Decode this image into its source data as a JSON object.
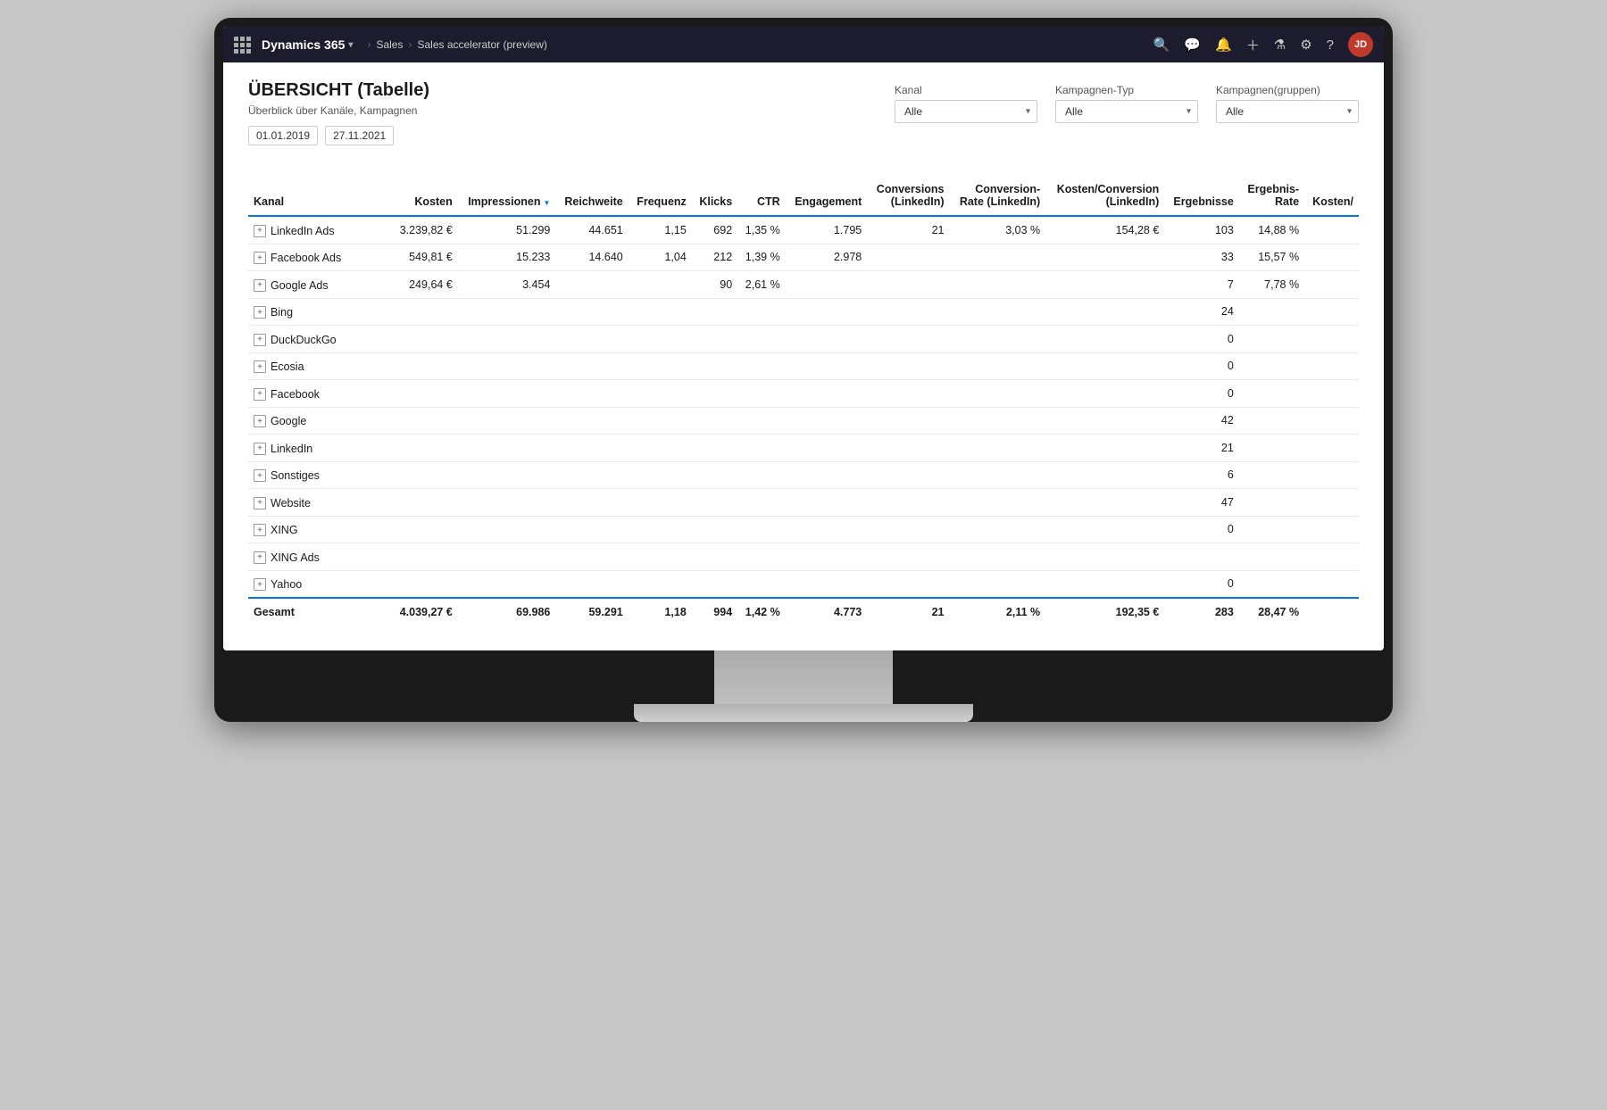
{
  "app": {
    "brand": "Dynamics 365",
    "breadcrumb": [
      "Sales",
      "Sales accelerator (preview)"
    ]
  },
  "topbar_icons": [
    "search",
    "chat",
    "notifications",
    "add",
    "funnel",
    "settings",
    "help"
  ],
  "topbar_avatar_initials": "JD",
  "page": {
    "title": "ÜBERSICHT (Tabelle)",
    "subtitle": "Überblick über Kanäle, Kampagnen",
    "date_from": "01.01.2019",
    "date_to": "27.11.2021"
  },
  "filters": {
    "kanal": {
      "label": "Kanal",
      "value": "Alle"
    },
    "kampagnen_typ": {
      "label": "Kampagnen-Typ",
      "value": "Alle"
    },
    "kampagnen_gruppen": {
      "label": "Kampagnen(gruppen)",
      "value": "Alle"
    }
  },
  "table": {
    "columns": [
      "Kanal",
      "Kosten",
      "Impressionen",
      "Reichweite",
      "Frequenz",
      "Klicks",
      "CTR",
      "Engagement",
      "Conversions (LinkedIn)",
      "Conversion-Rate (LinkedIn)",
      "Kosten/Conversion (LinkedIn)",
      "Ergebnisse",
      "Ergebnis-Rate",
      "Kosten/"
    ],
    "rows": [
      {
        "kanal": "LinkedIn Ads",
        "kosten": "3.239,82 €",
        "impressionen": "51.299",
        "reichweite": "44.651",
        "frequenz": "1,15",
        "klicks": "692",
        "ctr": "1,35 %",
        "engagement": "1.795",
        "conversions_li": "21",
        "conv_rate_li": "3,03 %",
        "kosten_conv_li": "154,28 €",
        "ergebnisse": "103",
        "ergebnis_rate": "14,88 %",
        "kosten_col": ""
      },
      {
        "kanal": "Facebook Ads",
        "kosten": "549,81 €",
        "impressionen": "15.233",
        "reichweite": "14.640",
        "frequenz": "1,04",
        "klicks": "212",
        "ctr": "1,39 %",
        "engagement": "2.978",
        "conversions_li": "",
        "conv_rate_li": "",
        "kosten_conv_li": "",
        "ergebnisse": "33",
        "ergebnis_rate": "15,57 %",
        "kosten_col": ""
      },
      {
        "kanal": "Google Ads",
        "kosten": "249,64 €",
        "impressionen": "3.454",
        "reichweite": "",
        "frequenz": "",
        "klicks": "90",
        "ctr": "2,61 %",
        "engagement": "",
        "conversions_li": "",
        "conv_rate_li": "",
        "kosten_conv_li": "",
        "ergebnisse": "7",
        "ergebnis_rate": "7,78 %",
        "kosten_col": ""
      },
      {
        "kanal": "Bing",
        "kosten": "",
        "impressionen": "",
        "reichweite": "",
        "frequenz": "",
        "klicks": "",
        "ctr": "",
        "engagement": "",
        "conversions_li": "",
        "conv_rate_li": "",
        "kosten_conv_li": "",
        "ergebnisse": "24",
        "ergebnis_rate": "",
        "kosten_col": ""
      },
      {
        "kanal": "DuckDuckGo",
        "kosten": "",
        "impressionen": "",
        "reichweite": "",
        "frequenz": "",
        "klicks": "",
        "ctr": "",
        "engagement": "",
        "conversions_li": "",
        "conv_rate_li": "",
        "kosten_conv_li": "",
        "ergebnisse": "0",
        "ergebnis_rate": "",
        "kosten_col": ""
      },
      {
        "kanal": "Ecosia",
        "kosten": "",
        "impressionen": "",
        "reichweite": "",
        "frequenz": "",
        "klicks": "",
        "ctr": "",
        "engagement": "",
        "conversions_li": "",
        "conv_rate_li": "",
        "kosten_conv_li": "",
        "ergebnisse": "0",
        "ergebnis_rate": "",
        "kosten_col": ""
      },
      {
        "kanal": "Facebook",
        "kosten": "",
        "impressionen": "",
        "reichweite": "",
        "frequenz": "",
        "klicks": "",
        "ctr": "",
        "engagement": "",
        "conversions_li": "",
        "conv_rate_li": "",
        "kosten_conv_li": "",
        "ergebnisse": "0",
        "ergebnis_rate": "",
        "kosten_col": ""
      },
      {
        "kanal": "Google",
        "kosten": "",
        "impressionen": "",
        "reichweite": "",
        "frequenz": "",
        "klicks": "",
        "ctr": "",
        "engagement": "",
        "conversions_li": "",
        "conv_rate_li": "",
        "kosten_conv_li": "",
        "ergebnisse": "42",
        "ergebnis_rate": "",
        "kosten_col": ""
      },
      {
        "kanal": "LinkedIn",
        "kosten": "",
        "impressionen": "",
        "reichweite": "",
        "frequenz": "",
        "klicks": "",
        "ctr": "",
        "engagement": "",
        "conversions_li": "",
        "conv_rate_li": "",
        "kosten_conv_li": "",
        "ergebnisse": "21",
        "ergebnis_rate": "",
        "kosten_col": ""
      },
      {
        "kanal": "Sonstiges",
        "kosten": "",
        "impressionen": "",
        "reichweite": "",
        "frequenz": "",
        "klicks": "",
        "ctr": "",
        "engagement": "",
        "conversions_li": "",
        "conv_rate_li": "",
        "kosten_conv_li": "",
        "ergebnisse": "6",
        "ergebnis_rate": "",
        "kosten_col": ""
      },
      {
        "kanal": "Website",
        "kosten": "",
        "impressionen": "",
        "reichweite": "",
        "frequenz": "",
        "klicks": "",
        "ctr": "",
        "engagement": "",
        "conversions_li": "",
        "conv_rate_li": "",
        "kosten_conv_li": "",
        "ergebnisse": "47",
        "ergebnis_rate": "",
        "kosten_col": ""
      },
      {
        "kanal": "XING",
        "kosten": "",
        "impressionen": "",
        "reichweite": "",
        "frequenz": "",
        "klicks": "",
        "ctr": "",
        "engagement": "",
        "conversions_li": "",
        "conv_rate_li": "",
        "kosten_conv_li": "",
        "ergebnisse": "0",
        "ergebnis_rate": "",
        "kosten_col": ""
      },
      {
        "kanal": "XING Ads",
        "kosten": "",
        "impressionen": "",
        "reichweite": "",
        "frequenz": "",
        "klicks": "",
        "ctr": "",
        "engagement": "",
        "conversions_li": "",
        "conv_rate_li": "",
        "kosten_conv_li": "",
        "ergebnisse": "",
        "ergebnis_rate": "",
        "kosten_col": ""
      },
      {
        "kanal": "Yahoo",
        "kosten": "",
        "impressionen": "",
        "reichweite": "",
        "frequenz": "",
        "klicks": "",
        "ctr": "",
        "engagement": "",
        "conversions_li": "",
        "conv_rate_li": "",
        "kosten_conv_li": "",
        "ergebnisse": "0",
        "ergebnis_rate": "",
        "kosten_col": ""
      }
    ],
    "totals": {
      "label": "Gesamt",
      "kosten": "4.039,27 €",
      "impressionen": "69.986",
      "reichweite": "59.291",
      "frequenz": "1,18",
      "klicks": "994",
      "ctr": "1,42 %",
      "engagement": "4.773",
      "conversions_li": "21",
      "conv_rate_li": "2,11 %",
      "kosten_conv_li": "192,35 €",
      "ergebnisse": "283",
      "ergebnis_rate": "28,47 %",
      "kosten_col": ""
    }
  }
}
